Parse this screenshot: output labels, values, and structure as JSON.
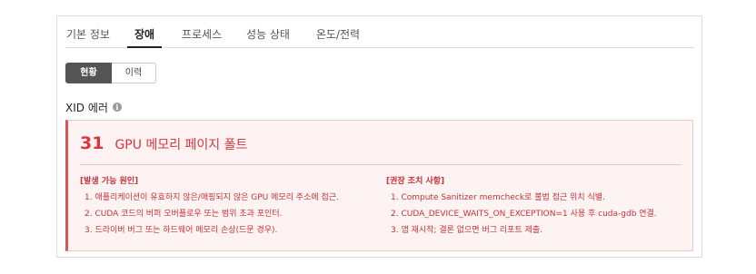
{
  "tabs": [
    {
      "label": "기본 정보",
      "active": false
    },
    {
      "label": "장애",
      "active": true
    },
    {
      "label": "프로세스",
      "active": false
    },
    {
      "label": "성능 상태",
      "active": false
    },
    {
      "label": "온도/전력",
      "active": false
    }
  ],
  "segment": {
    "current_label": "현황",
    "history_label": "이력",
    "selected": "현황"
  },
  "section": {
    "title": "XID 에러",
    "info_icon": "i"
  },
  "error": {
    "code": "31",
    "title": "GPU 메모리 페이지 폴트",
    "causes_title": "[발생 가능 원인]",
    "causes": [
      "1. 애플리케이션이 유효하지 않은/매핑되지 않은 GPU 메모리 주소에 접근.",
      "2. CUDA 코드의 버퍼 오버플로우 또는 범위 초과 포인터.",
      "3. 드라이버 버그 또는 하드웨어 메모리 손상(드문 경우)."
    ],
    "actions_title": "[권장 조치 사항]",
    "actions": [
      "1. Compute Sanitizer memcheck로 불법 접근 위치 식별.",
      "2. CUDA_DEVICE_WAITS_ON_EXCEPTION=1 사용 후 cuda-gdb 연결.",
      "3. 앱 재시작; 결론 없으면 버그 리포트 제출."
    ]
  },
  "colors": {
    "accent": "#d9343f",
    "error_bg": "#fef3f3",
    "error_border": "#f2c5c7",
    "tab_active": "#222222"
  }
}
